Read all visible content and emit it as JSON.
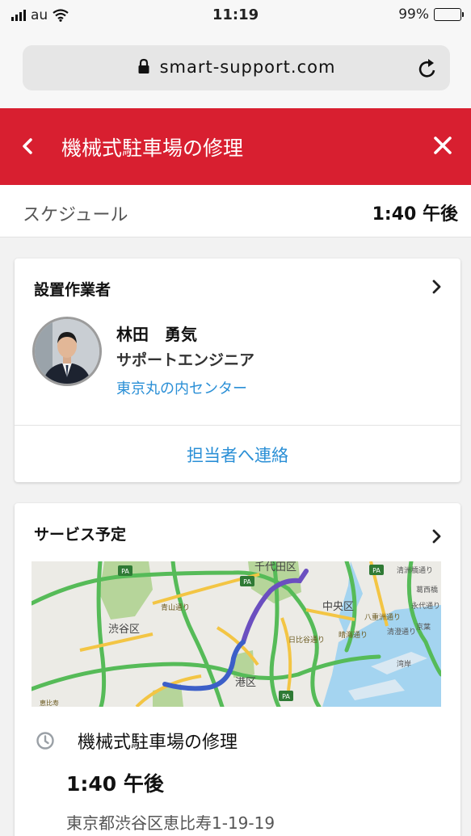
{
  "status_bar": {
    "carrier": "au",
    "time": "11:19",
    "battery": "99%"
  },
  "browser": {
    "url": "smart-support.com"
  },
  "nav": {
    "title": "機械式駐車場の修理"
  },
  "schedule": {
    "label": "スケジュール",
    "time": "1:40 午後"
  },
  "installer": {
    "title": "設置作業者",
    "name": "林田　勇気",
    "role": "サポートエンジニア",
    "office": "東京丸の内センター",
    "contact_label": "担当者へ連絡"
  },
  "service": {
    "title": "サービス予定",
    "map_labels": {
      "chiyoda": "千代田区",
      "chuo": "中央区",
      "shibuya": "渋谷区",
      "minato": "港区",
      "aoyama": "青山通り",
      "hibiya": "日比谷通り",
      "harumi": "晴海通り",
      "yaesu": "八重洲通り",
      "kasai": "葛西橋",
      "eitai": "永代通り",
      "kiyosumi": "清洲橋通り",
      "shimizu": "清澄通り",
      "keiyo": "京葉",
      "harbor": "湾岸",
      "ebisu": "恵比寿",
      "pa": "PA"
    },
    "job_title": "機械式駐車場の修理",
    "job_time": "1:40 午後",
    "address": "東京都渋谷区恵比寿1-19-19"
  }
}
